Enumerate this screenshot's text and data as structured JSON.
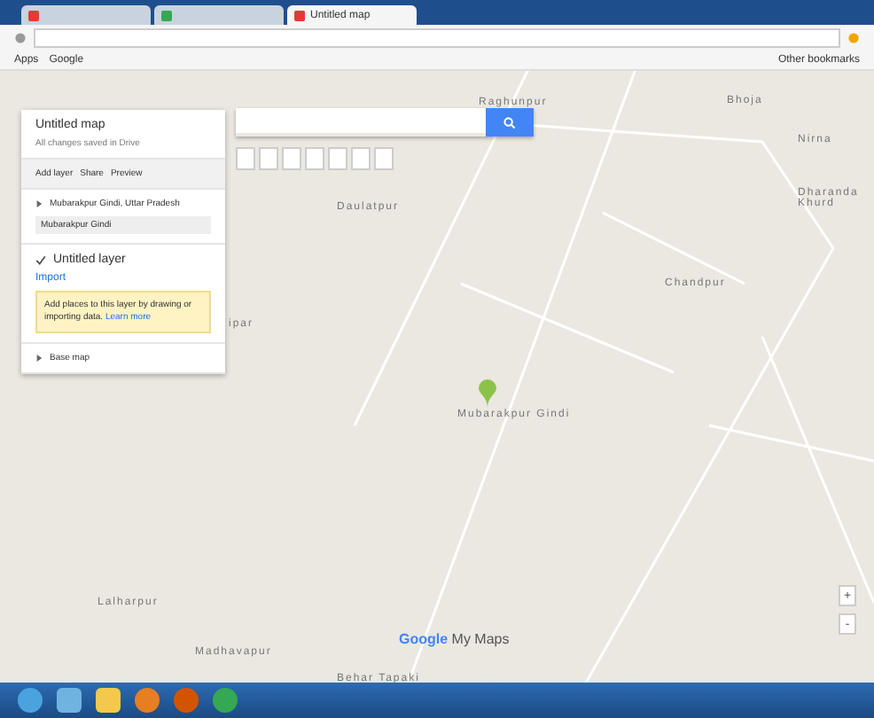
{
  "browser": {
    "tabs": [
      {
        "selected": false
      },
      {
        "selected": false
      },
      {
        "title": "Untitled map",
        "selected": true
      }
    ],
    "bookmarks": [
      "Apps",
      "Google"
    ],
    "other_bookmarks": "Other bookmarks"
  },
  "panel": {
    "title": "Untitled map",
    "subtitle": "All changes saved in Drive",
    "actions": [
      "Add layer",
      "Share",
      "Preview"
    ],
    "search_layer": {
      "title": "Mubarakpur Gindi, Uttar Pradesh",
      "expanded": false,
      "places": [
        "Mubarakpur Gindi"
      ]
    },
    "layer": {
      "title": "Untitled layer",
      "checked": true,
      "import": "Import",
      "hint": "Add places to this layer by drawing or importing data.",
      "hint_link": "Learn more"
    },
    "base_map": {
      "title": "Base map",
      "expanded": false
    }
  },
  "map": {
    "labels": [
      "Raghunpur",
      "Daulatpur",
      "Bhoja",
      "Nirna",
      "Dharanda Khurd",
      "Chandpur",
      "ipar",
      "Lalharpur",
      "Madhavapur",
      "Behar Tapaki"
    ],
    "marker": {
      "label": "Mubarakpur Gindi",
      "color": "#8bc34a"
    },
    "brand": {
      "google": "Google",
      "product": "My Maps"
    },
    "zoom": {
      "in": "+",
      "out": "-"
    }
  }
}
